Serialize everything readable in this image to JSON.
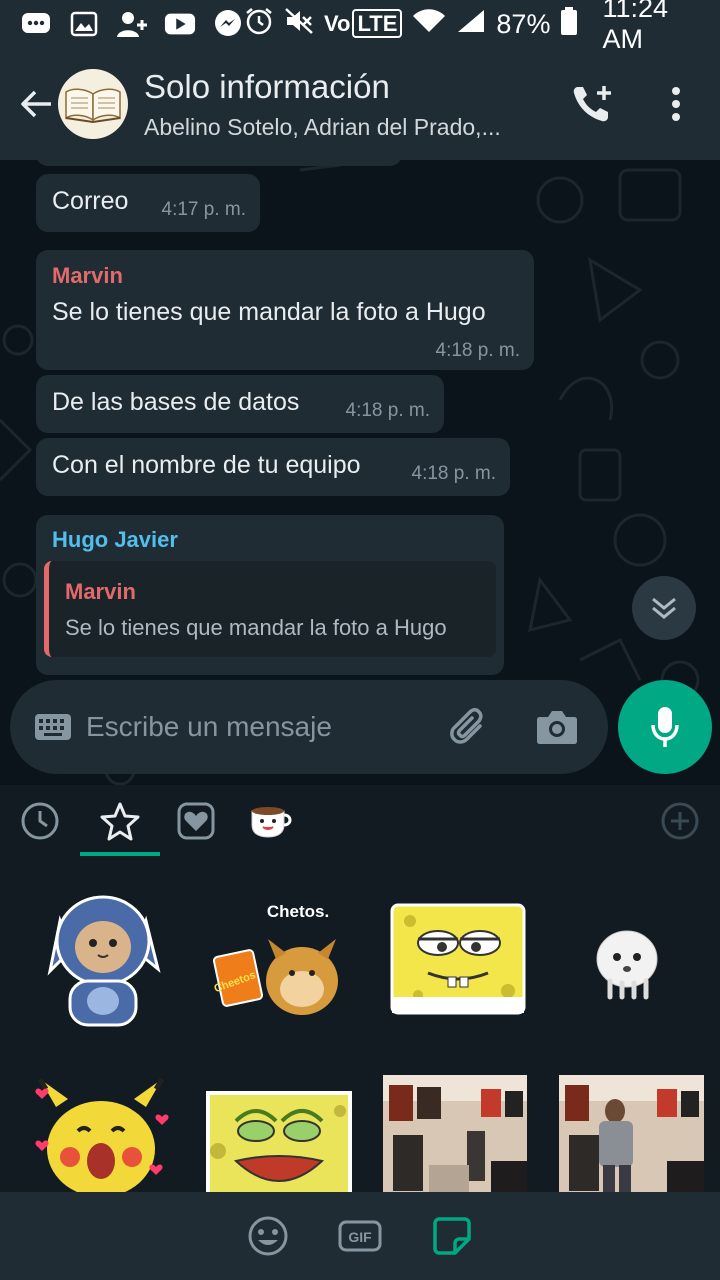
{
  "status_bar": {
    "battery": "87%",
    "time": "11:24 AM",
    "volte": "Vo",
    "lte": "LTE",
    "icons": [
      "chat-icon",
      "gallery-icon",
      "add-contact-icon",
      "youtube-icon",
      "messenger-icon",
      "alarm-icon",
      "mute-icon",
      "wifi-icon",
      "signal-icon",
      "battery-icon"
    ]
  },
  "header": {
    "title": "Solo información",
    "subtitle": "Abelino Sotelo, Adrian del Prado,..."
  },
  "messages": [
    {
      "text": "Correo",
      "time": "4:17 p. m."
    },
    {
      "sender": "Marvin",
      "text": "Se lo tienes que mandar la foto a Hugo",
      "time": "4:18 p. m."
    },
    {
      "text": "De las bases de datos",
      "time": "4:18 p. m."
    },
    {
      "text": "Con el nombre de tu equipo",
      "time": "4:18 p. m."
    },
    {
      "sender": "Hugo Javier",
      "quote_sender": "Marvin",
      "quote_text": "Se lo tienes que mandar la foto a Hugo"
    }
  ],
  "colors": {
    "accent": "#00a884",
    "marvin": "#e26a6a",
    "hugo": "#53bdeb"
  },
  "composer": {
    "placeholder": "Escribe un mensaje"
  },
  "stickers": {
    "tabs": [
      "recent-icon",
      "star-icon",
      "heart-icon",
      "coffee-pack-icon",
      "add-pack-icon"
    ],
    "items": [
      {
        "name": "cat-costume-sticker"
      },
      {
        "name": "cheems-chetos-sticker",
        "caption": "Chetos.",
        "bag_text": "Cheetos"
      },
      {
        "name": "spongebob-sticker"
      },
      {
        "name": "ghost-sticker"
      },
      {
        "name": "pikachu-hearts-sticker"
      },
      {
        "name": "spongebob-scream-sticker"
      },
      {
        "name": "room-photo-sticker-1"
      },
      {
        "name": "room-photo-sticker-2"
      }
    ]
  },
  "bottom_bar": {
    "gif_label": "GIF"
  }
}
